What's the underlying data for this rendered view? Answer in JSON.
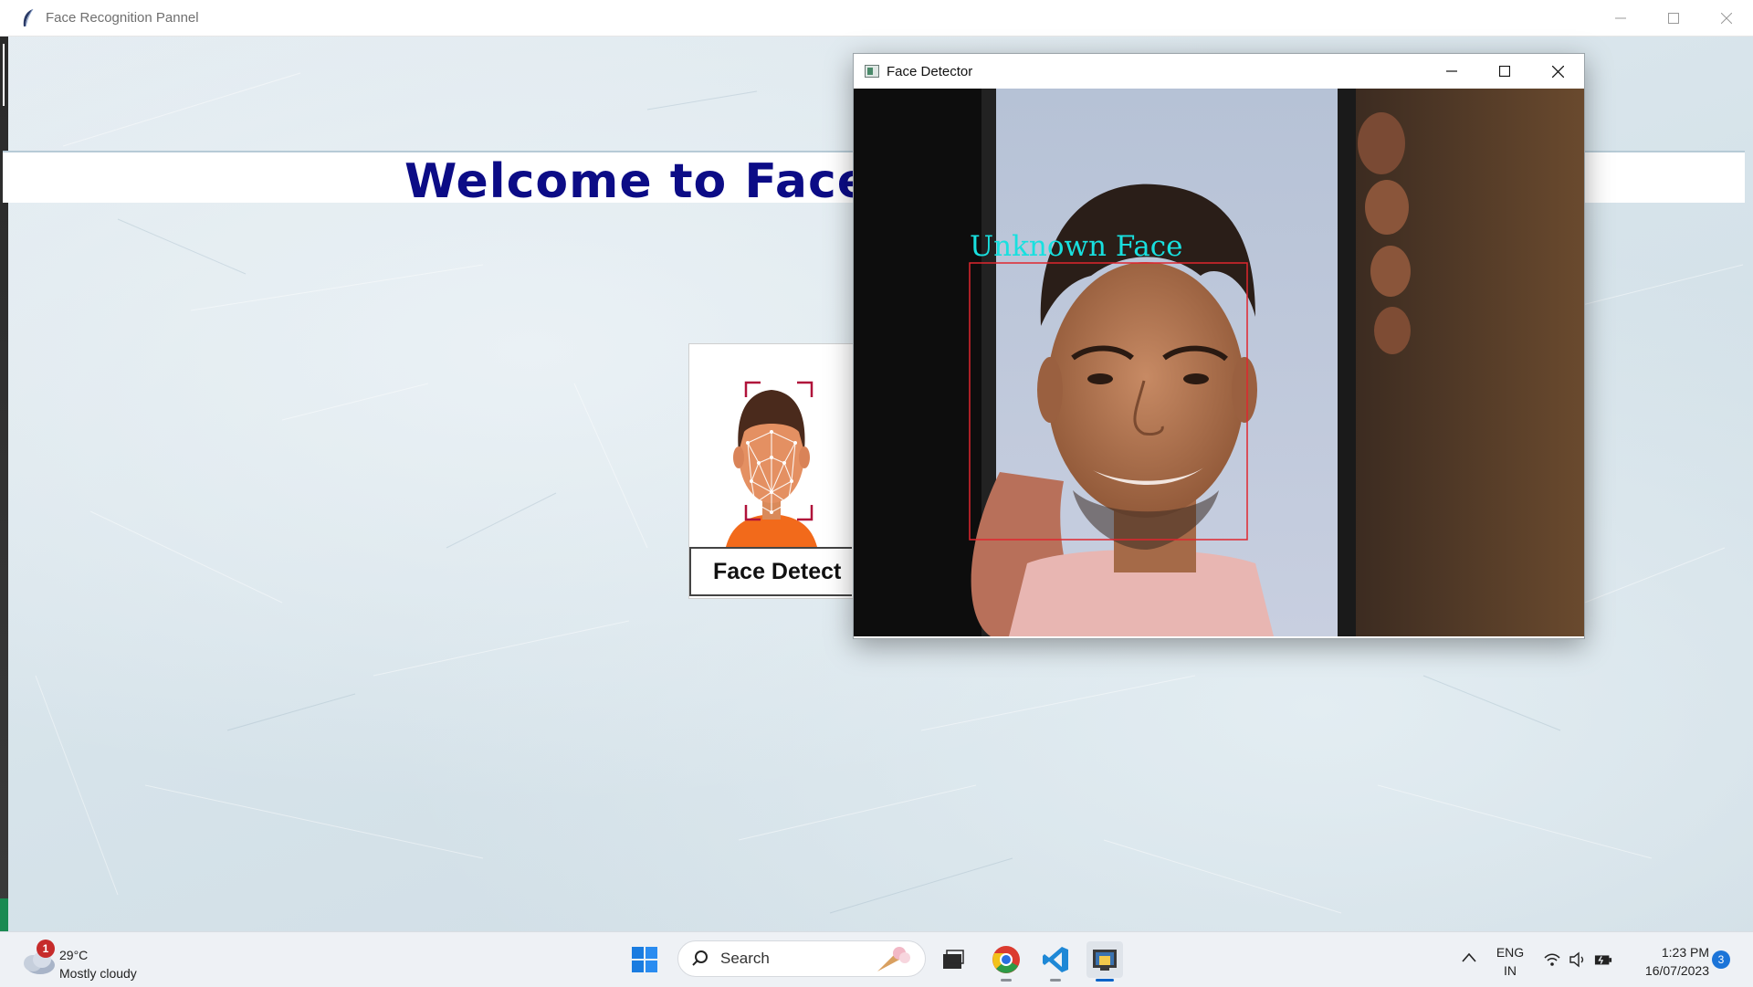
{
  "main_window": {
    "title": "Face Recognition Pannel",
    "controls": [
      "minimize",
      "maximize",
      "close"
    ]
  },
  "banner": {
    "text": "Welcome to Face"
  },
  "detect_card": {
    "button_label": "Face Detect",
    "illustration": "face-mesh-illustration"
  },
  "face_detector": {
    "title": "Face Detector",
    "detection_label": "Unknown Face",
    "box_color": "#e0262e",
    "label_color": "#18e0df"
  },
  "taskbar": {
    "weather": {
      "badge": "1",
      "temp": "29°C",
      "desc": "Mostly cloudy"
    },
    "search_label": "Search",
    "apps": [
      "windows-start",
      "task-view",
      "chrome",
      "vscode",
      "python"
    ],
    "lang_line1": "ENG",
    "lang_line2": "IN",
    "time": "1:23 PM",
    "date": "16/07/2023",
    "notifications": "3"
  }
}
